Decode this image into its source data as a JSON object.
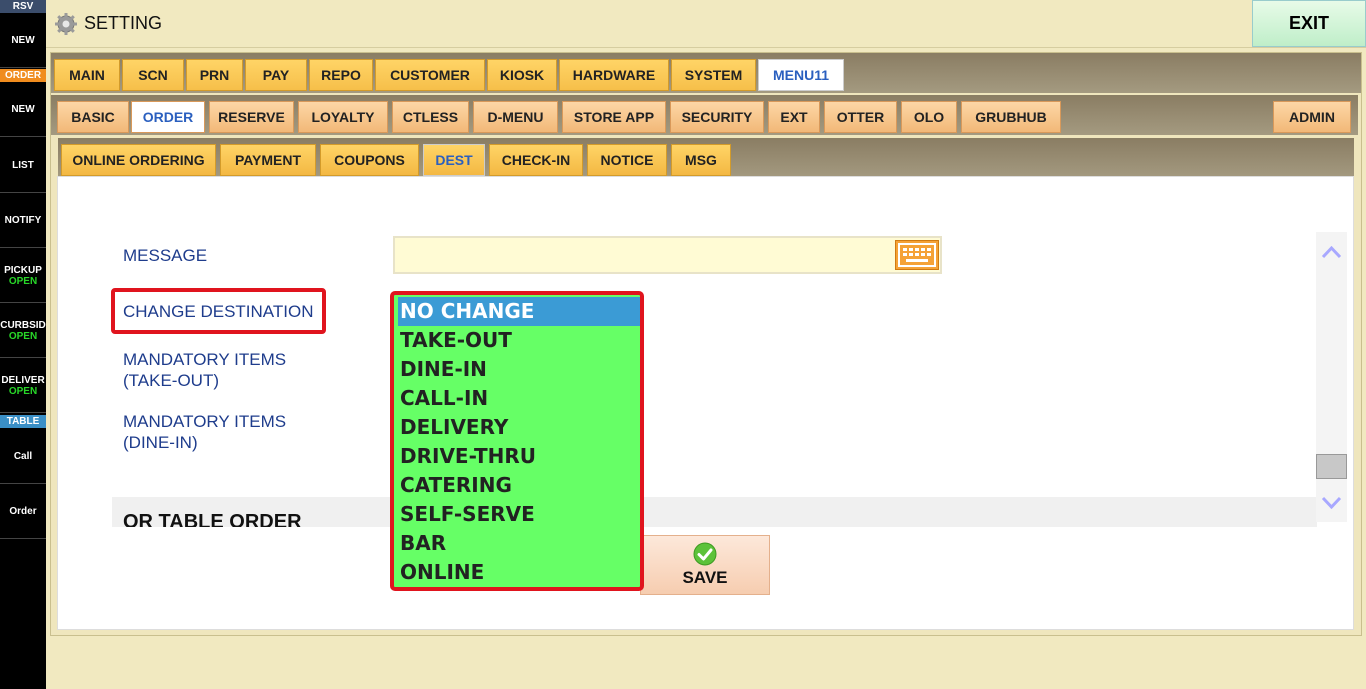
{
  "app": {
    "title": "SETTING",
    "exit_label": "EXIT"
  },
  "sidebar": {
    "headers": [
      "RSV",
      "ORDER",
      "TABLE"
    ],
    "header_colors": [
      "#3b4d6b",
      "#f08c1e",
      "#3a8fc6"
    ],
    "items": [
      {
        "label": "NEW",
        "sub": ""
      },
      {
        "label": "NEW",
        "sub": ""
      },
      {
        "label": "LIST",
        "sub": ""
      },
      {
        "label": "NOTIFY",
        "sub": ""
      },
      {
        "label": "PICKUP",
        "sub": "OPEN"
      },
      {
        "label": "CURBSID",
        "sub": "OPEN"
      },
      {
        "label": "DELIVER",
        "sub": "OPEN"
      },
      {
        "label": "Call",
        "sub": ""
      },
      {
        "label": "Order",
        "sub": ""
      }
    ]
  },
  "tabs_row1": [
    "MAIN",
    "SCN",
    "PRN",
    "PAY",
    "REPO",
    "CUSTOMER",
    "KIOSK",
    "HARDWARE",
    "SYSTEM",
    "MENU11"
  ],
  "tabs_row1_active": "MENU11",
  "tabs_row2": [
    "BASIC",
    "ORDER",
    "RESERVE",
    "LOYALTY",
    "CTLESS",
    "D-MENU",
    "STORE APP",
    "SECURITY",
    "EXT",
    "OTTER",
    "OLO",
    "GRUBHUB",
    "ADMIN"
  ],
  "tabs_row2_active": "ORDER",
  "tabs_row3": [
    "ONLINE ORDERING",
    "PAYMENT",
    "COUPONS",
    "DEST",
    "CHECK-IN",
    "NOTICE",
    "MSG"
  ],
  "tabs_row3_active": "DEST",
  "form": {
    "message_label": "MESSAGE",
    "message_value": "",
    "change_destination_label": "CHANGE DESTINATION",
    "mandatory_takeout_line1": "MANDATORY ITEMS",
    "mandatory_takeout_line2": "(TAKE-OUT)",
    "mandatory_dinein_line1": "MANDATORY ITEMS",
    "mandatory_dinein_line2": "(DINE-IN)",
    "section_title": "OR TABLE ORDER"
  },
  "dropdown": {
    "selected": "NO CHANGE",
    "options": [
      "NO CHANGE",
      "TAKE-OUT",
      "DINE-IN",
      "CALL-IN",
      "DELIVERY",
      "DRIVE-THRU",
      "CATERING",
      "SELF-SERVE",
      "BAR",
      "ONLINE"
    ]
  },
  "save_label": "SAVE",
  "icons": {
    "settings": "gear-icon",
    "keyboard": "keyboard-icon",
    "save": "check-circle-icon",
    "scroll_up": "chevron-up-icon",
    "scroll_down": "chevron-down-icon"
  },
  "colors": {
    "highlight_red": "#e0141e",
    "dropdown_bg": "#66ff66",
    "selected_bg": "#3b9bd5"
  }
}
